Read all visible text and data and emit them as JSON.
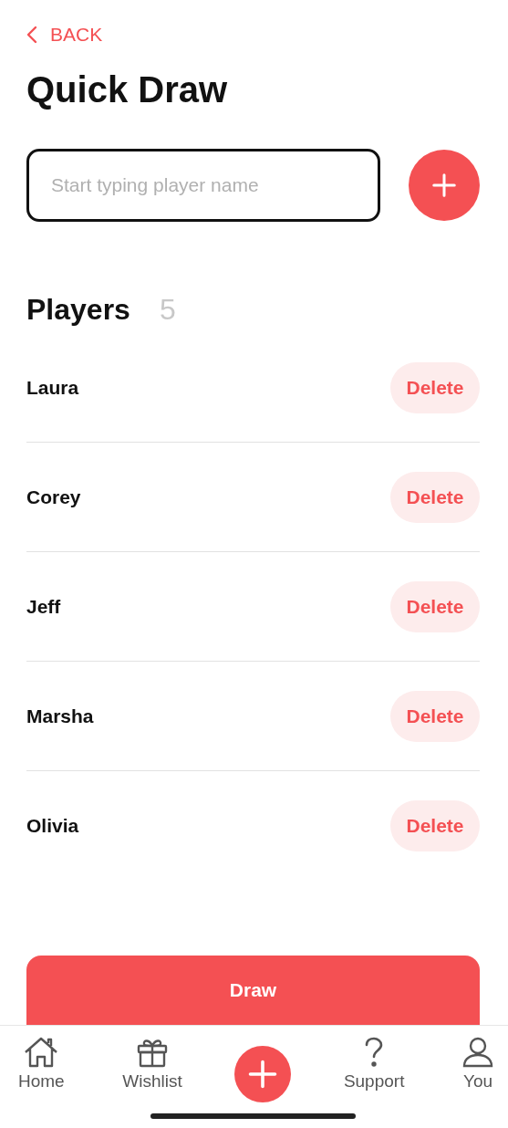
{
  "back": {
    "label": "BACK"
  },
  "title": "Quick Draw",
  "player_input": {
    "placeholder": "Start typing player name"
  },
  "players": {
    "heading": "Players",
    "count": "5",
    "items": [
      {
        "name": "Laura",
        "action": "Delete"
      },
      {
        "name": "Corey",
        "action": "Delete"
      },
      {
        "name": "Jeff",
        "action": "Delete"
      },
      {
        "name": "Marsha",
        "action": "Delete"
      },
      {
        "name": "Olivia",
        "action": "Delete"
      }
    ]
  },
  "draw_button": "Draw",
  "nav": [
    {
      "kind": "home",
      "label": "Home"
    },
    {
      "kind": "wishlist",
      "label": "Wishlist"
    },
    {
      "kind": "add"
    },
    {
      "kind": "support",
      "label": "Support"
    },
    {
      "kind": "you",
      "label": "You"
    }
  ]
}
